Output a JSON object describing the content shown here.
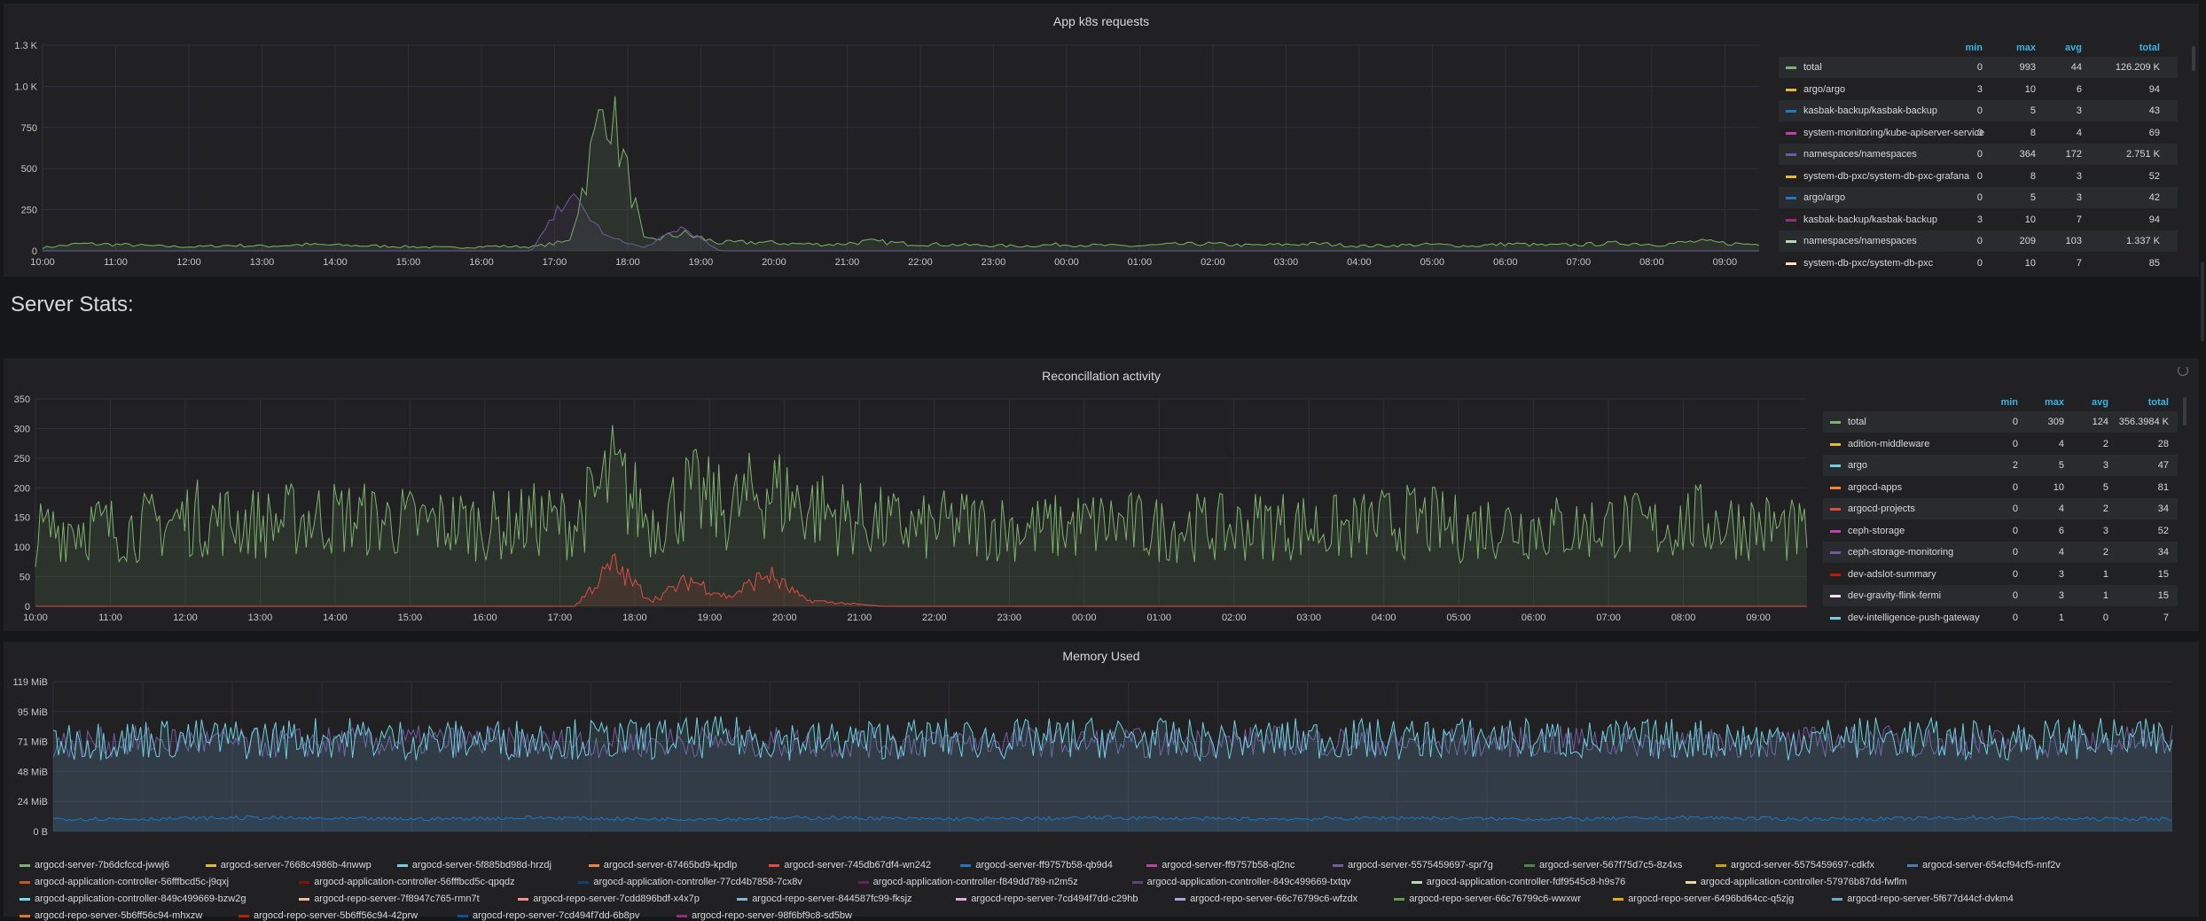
{
  "colors": {
    "green": "#7eb26d",
    "yellow": "#eab839",
    "blue": "#1f78c1",
    "cyan": "#6ed0e0",
    "orange": "#ef843c",
    "red": "#e24d42",
    "magenta": "#ba43a9",
    "purple": "#705da0",
    "olive": "#508642",
    "lavender": "#b7dbab"
  },
  "panel1": {
    "title": "App k8s requests",
    "legend_headers": {
      "min": "min",
      "max": "max",
      "avg": "avg",
      "total": "total"
    },
    "legend": [
      {
        "name": "total",
        "min": "0",
        "max": "993",
        "avg": "44",
        "total": "126.209 K",
        "color": "#7eb26d"
      },
      {
        "name": "argo/argo",
        "min": "3",
        "max": "10",
        "avg": "6",
        "total": "94",
        "color": "#eab839"
      },
      {
        "name": "kasbak-backup/kasbak-backup",
        "min": "0",
        "max": "5",
        "avg": "3",
        "total": "43",
        "color": "#1f78c1"
      },
      {
        "name": "system-monitoring/kube-apiserver-service",
        "min": "0",
        "max": "8",
        "avg": "4",
        "total": "69",
        "color": "#ba43a9"
      },
      {
        "name": "namespaces/namespaces",
        "min": "0",
        "max": "364",
        "avg": "172",
        "total": "2.751 K",
        "color": "#705da0"
      },
      {
        "name": "system-db-pxc/system-db-pxc-grafana",
        "min": "0",
        "max": "8",
        "avg": "3",
        "total": "52",
        "color": "#eab839"
      },
      {
        "name": "argo/argo",
        "min": "0",
        "max": "5",
        "avg": "3",
        "total": "42",
        "color": "#1f78c1"
      },
      {
        "name": "kasbak-backup/kasbak-backup",
        "min": "3",
        "max": "10",
        "avg": "7",
        "total": "94",
        "color": "#962d82"
      },
      {
        "name": "namespaces/namespaces",
        "min": "0",
        "max": "209",
        "avg": "103",
        "total": "1.337 K",
        "color": "#b7dbab"
      },
      {
        "name": "system-db-pxc/system-db-pxc",
        "min": "0",
        "max": "10",
        "avg": "7",
        "total": "85",
        "color": "#f9e2d2"
      }
    ]
  },
  "row_title": "Server Stats:",
  "panel2": {
    "title": "Reconcillation activity",
    "legend_headers": {
      "min": "min",
      "max": "max",
      "avg": "avg",
      "total": "total"
    },
    "legend": [
      {
        "name": "total",
        "min": "0",
        "max": "309",
        "avg": "124",
        "total": "356.3984 K",
        "color": "#7eb26d"
      },
      {
        "name": "adition-middleware",
        "min": "0",
        "max": "4",
        "avg": "2",
        "total": "28",
        "color": "#eab839"
      },
      {
        "name": "argo",
        "min": "2",
        "max": "5",
        "avg": "3",
        "total": "47",
        "color": "#6ed0e0"
      },
      {
        "name": "argocd-apps",
        "min": "0",
        "max": "10",
        "avg": "5",
        "total": "81",
        "color": "#ef843c"
      },
      {
        "name": "argocd-projects",
        "min": "0",
        "max": "4",
        "avg": "2",
        "total": "34",
        "color": "#e24d42"
      },
      {
        "name": "ceph-storage",
        "min": "0",
        "max": "6",
        "avg": "3",
        "total": "52",
        "color": "#ba43a9"
      },
      {
        "name": "ceph-storage-monitoring",
        "min": "0",
        "max": "4",
        "avg": "2",
        "total": "34",
        "color": "#705da0"
      },
      {
        "name": "dev-adslot-summary",
        "min": "0",
        "max": "3",
        "avg": "1",
        "total": "15",
        "color": "#bf1b00"
      },
      {
        "name": "dev-gravity-flink-fermi",
        "min": "0",
        "max": "3",
        "avg": "1",
        "total": "15",
        "color": "#f9d9f9"
      },
      {
        "name": "dev-intelligence-push-gateway",
        "min": "0",
        "max": "1",
        "avg": "0",
        "total": "7",
        "color": "#6ed0e0"
      }
    ]
  },
  "panel3": {
    "title": "Memory Used",
    "legend": [
      {
        "name": "argocd-server-7b6dcfccd-jwwj6",
        "color": "#7eb26d"
      },
      {
        "name": "argocd-server-7668c4986b-4nwwp",
        "color": "#eab839"
      },
      {
        "name": "argocd-server-5f885bd98d-hrzdj",
        "color": "#6ed0e0"
      },
      {
        "name": "argocd-server-67465bd9-kpdlp",
        "color": "#ef843c"
      },
      {
        "name": "argocd-server-745db67df4-wn242",
        "color": "#e24d42"
      },
      {
        "name": "argocd-server-ff9757b58-qb9d4",
        "color": "#1f78c1"
      },
      {
        "name": "argocd-server-ff9757b58-ql2nc",
        "color": "#ba43a9"
      },
      {
        "name": "argocd-server-5575459697-spr7g",
        "color": "#705da0"
      },
      {
        "name": "argocd-server-567f75d7c5-8z4xs",
        "color": "#508642"
      },
      {
        "name": "argocd-server-5575459697-cdkfx",
        "color": "#cca300"
      },
      {
        "name": "argocd-server-654cf94cf5-nnf2v",
        "color": "#447ebc"
      },
      {
        "name": "argocd-application-controller-56fffbcd5c-j9qxj",
        "color": "#c15c17"
      },
      {
        "name": "argocd-application-controller-56fffbcd5c-qpqdz",
        "color": "#890f02"
      },
      {
        "name": "argocd-application-controller-77cd4b7858-7cx8v",
        "color": "#0a437c"
      },
      {
        "name": "argocd-application-controller-f849dd789-n2m5z",
        "color": "#6d1f62"
      },
      {
        "name": "argocd-application-controller-849c499669-txtqv",
        "color": "#584477"
      },
      {
        "name": "argocd-application-controller-fdf9545c8-h9s76",
        "color": "#b7dbab"
      },
      {
        "name": "argocd-application-controller-57976b87dd-fwflm",
        "color": "#f4d598"
      },
      {
        "name": "argocd-application-controller-849c499669-bzw2g",
        "color": "#70dbed"
      },
      {
        "name": "argocd-repo-server-7f8947c765-rmn7t",
        "color": "#f9ba8f"
      },
      {
        "name": "argocd-repo-server-7cdd896bdf-x4x7p",
        "color": "#f29191"
      },
      {
        "name": "argocd-repo-server-844587fc99-fksjz",
        "color": "#82b5d8"
      },
      {
        "name": "argocd-repo-server-7cd494f7dd-c29hb",
        "color": "#e5a8e2"
      },
      {
        "name": "argocd-repo-server-66c76799c6-wfzdx",
        "color": "#aea2e0"
      },
      {
        "name": "argocd-repo-server-66c76799c6-wwxwr",
        "color": "#629e51"
      },
      {
        "name": "argocd-repo-server-6496bd64cc-q5zjg",
        "color": "#e5ac0e"
      },
      {
        "name": "argocd-repo-server-5f677d44cf-dvkm4",
        "color": "#64b0c8"
      },
      {
        "name": "argocd-repo-server-5b6ff56c94-mhxzw",
        "color": "#e0752d"
      },
      {
        "name": "argocd-repo-server-5b6ff56c94-42prw",
        "color": "#bf1b00"
      },
      {
        "name": "argocd-repo-server-7cd494f7dd-6b8pv",
        "color": "#0a50a1"
      },
      {
        "name": "argocd-repo-server-98f6bf9c8-sd5bw",
        "color": "#962d82"
      }
    ]
  },
  "chart_data": [
    {
      "type": "line",
      "title": "App k8s requests",
      "ylim": [
        0,
        1300
      ],
      "y_ticks": [
        "0",
        "250",
        "500",
        "750",
        "1.0 K",
        "1.3 K"
      ],
      "x_ticks": [
        "10:00",
        "11:00",
        "12:00",
        "13:00",
        "14:00",
        "15:00",
        "16:00",
        "17:00",
        "18:00",
        "19:00",
        "20:00",
        "21:00",
        "22:00",
        "23:00",
        "00:00",
        "01:00",
        "02:00",
        "03:00",
        "04:00",
        "05:00",
        "06:00",
        "07:00",
        "08:00",
        "09:00"
      ],
      "series": [
        {
          "name": "total",
          "values": [
            20,
            45,
            40,
            30,
            25,
            35,
            30,
            40,
            35,
            30,
            25,
            20,
            30,
            25,
            60,
            990,
            60,
            110,
            50,
            55,
            45,
            40,
            60,
            45,
            40,
            35,
            30,
            40,
            35,
            30,
            40,
            45,
            35,
            40,
            45,
            30,
            35,
            40,
            30,
            45,
            35,
            40,
            50,
            40,
            60,
            45,
            40
          ]
        },
        {
          "name": "namespaces/namespaces",
          "values": [
            0,
            0,
            0,
            0,
            0,
            0,
            0,
            0,
            0,
            0,
            0,
            0,
            0,
            0,
            360,
            90,
            20,
            150,
            0,
            0,
            0,
            0,
            0,
            0,
            0,
            0,
            0,
            0,
            0,
            0,
            0,
            0,
            0,
            0,
            0,
            0,
            0,
            0,
            0,
            0,
            0,
            0,
            0,
            0,
            0,
            0,
            0
          ]
        }
      ]
    },
    {
      "type": "line",
      "title": "Reconcillation activity",
      "ylim": [
        0,
        350
      ],
      "y_ticks": [
        "0",
        "50",
        "100",
        "150",
        "200",
        "250",
        "300",
        "350"
      ],
      "x_ticks": [
        "10:00",
        "11:00",
        "12:00",
        "13:00",
        "14:00",
        "15:00",
        "16:00",
        "17:00",
        "18:00",
        "19:00",
        "20:00",
        "21:00",
        "22:00",
        "23:00",
        "00:00",
        "01:00",
        "02:00",
        "03:00",
        "04:00",
        "05:00",
        "06:00",
        "07:00",
        "08:00",
        "09:00"
      ],
      "series": [
        {
          "name": "total",
          "values": [
            120,
            140,
            130,
            135,
            150,
            145,
            140,
            150,
            150,
            145,
            140,
            140,
            135,
            145,
            140,
            220,
            140,
            190,
            160,
            200,
            170,
            150,
            140,
            130,
            140,
            135,
            130,
            135,
            140,
            130,
            135,
            130,
            140,
            135,
            130,
            140,
            145,
            130,
            140,
            135,
            130,
            140,
            130,
            145,
            140,
            135,
            120
          ]
        },
        {
          "name": "argocd-projects",
          "values": [
            0,
            0,
            0,
            0,
            0,
            0,
            0,
            0,
            0,
            0,
            0,
            0,
            0,
            0,
            0,
            70,
            10,
            45,
            15,
            55,
            10,
            5,
            0,
            0,
            0,
            0,
            0,
            0,
            0,
            0,
            0,
            0,
            0,
            0,
            0,
            0,
            0,
            0,
            0,
            0,
            0,
            0,
            0,
            0,
            0,
            0,
            0
          ]
        }
      ]
    },
    {
      "type": "line",
      "title": "Memory Used",
      "ylim": [
        0,
        119
      ],
      "y_ticks": [
        "0 B",
        "24 MiB",
        "48 MiB",
        "71 MiB",
        "95 MiB",
        "119 MiB"
      ],
      "x_ticks": [
        "10:00",
        "11:00",
        "12:00",
        "13:00",
        "14:00",
        "15:00",
        "16:00",
        "17:00",
        "18:00",
        "19:00",
        "20:00",
        "21:00",
        "22:00",
        "23:00",
        "00:00",
        "01:00",
        "02:00",
        "03:00",
        "04:00",
        "05:00",
        "06:00",
        "07:00",
        "08:00",
        "09:00"
      ],
      "series": [
        {
          "name": "argocd-server-ff9757b58-ql2nc",
          "values": [
            70,
            72,
            70,
            71,
            72,
            70,
            71,
            72,
            70,
            71,
            72,
            70,
            71,
            72,
            70,
            71,
            72,
            70,
            71,
            72,
            70,
            71,
            72
          ]
        },
        {
          "name": "argocd-application-controller-849c499669-bzw2g",
          "values": [
            72,
            74,
            73,
            75,
            72,
            74,
            73,
            75,
            72,
            74,
            73,
            75,
            72,
            74,
            73,
            75,
            72,
            74,
            73,
            75,
            72,
            74,
            73
          ]
        },
        {
          "name": "argocd-server-654cf94cf5-nnf2v",
          "values": [
            10,
            10,
            11,
            10,
            10,
            11,
            10,
            10,
            11,
            10,
            10,
            11,
            10,
            10,
            11,
            10,
            10,
            11,
            10,
            10,
            11,
            10,
            10
          ]
        }
      ]
    }
  ]
}
